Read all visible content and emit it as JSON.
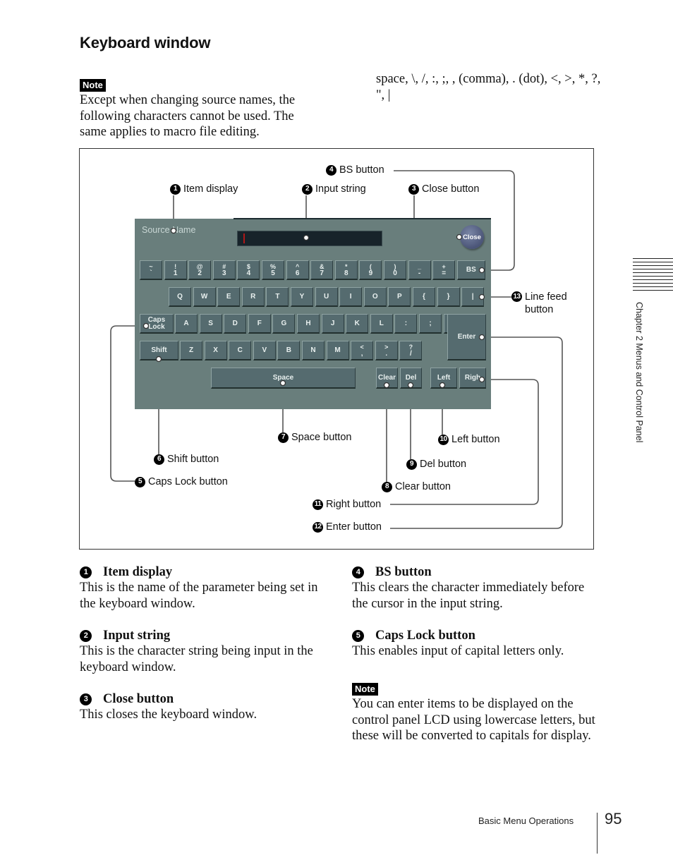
{
  "page": {
    "title": "Keyboard window",
    "note_label": "Note",
    "note_text": "Except when changing source names, the following characters cannot be used. The same applies to macro file editing.",
    "forbidden_chars": "space, \\, /, :, ;, , (comma), . (dot), <, >, *, ?, \", |"
  },
  "keyboard": {
    "item_display": "Source Name",
    "close_label": "Close",
    "row1": [
      {
        "top": "~",
        "bottom": "`"
      },
      {
        "top": "!",
        "bottom": "1"
      },
      {
        "top": "@",
        "bottom": "2"
      },
      {
        "top": "#",
        "bottom": "3"
      },
      {
        "top": "$",
        "bottom": "4"
      },
      {
        "top": "%",
        "bottom": "5"
      },
      {
        "top": "^",
        "bottom": "6"
      },
      {
        "top": "&",
        "bottom": "7"
      },
      {
        "top": "*",
        "bottom": "8"
      },
      {
        "top": "(",
        "bottom": "9"
      },
      {
        "top": ")",
        "bottom": "0"
      },
      {
        "top": "_",
        "bottom": "-"
      },
      {
        "top": "+",
        "bottom": "="
      }
    ],
    "bs_label": "BS",
    "row2": [
      "Q",
      "W",
      "E",
      "R",
      "T",
      "Y",
      "U",
      "I",
      "O",
      "P",
      "{",
      "}",
      "|"
    ],
    "caps_label": "Caps Lock",
    "row3": [
      "A",
      "S",
      "D",
      "F",
      "G",
      "H",
      "J",
      "K",
      "L",
      ":",
      ";",
      "\""
    ],
    "enter_label": "Enter",
    "shift_label": "Shift",
    "row4": [
      {
        "top": "",
        "bottom": "Z"
      },
      {
        "top": "",
        "bottom": "X"
      },
      {
        "top": "",
        "bottom": "C"
      },
      {
        "top": "",
        "bottom": "V"
      },
      {
        "top": "",
        "bottom": "B"
      },
      {
        "top": "",
        "bottom": "N"
      },
      {
        "top": "",
        "bottom": "M"
      },
      {
        "top": "<",
        "bottom": ","
      },
      {
        "top": ">",
        "bottom": "."
      },
      {
        "top": "?",
        "bottom": "/"
      }
    ],
    "space_label": "Space",
    "clear_label": "Clear",
    "del_label": "Del",
    "left_label": "Left",
    "right_label": "Righ"
  },
  "callouts": {
    "c1": {
      "num": "1",
      "label": "Item display"
    },
    "c2": {
      "num": "2",
      "label": "Input string"
    },
    "c3": {
      "num": "3",
      "label": "Close button"
    },
    "c4": {
      "num": "4",
      "label": "BS button"
    },
    "c5": {
      "num": "5",
      "label": "Caps Lock button"
    },
    "c6": {
      "num": "6",
      "label": "Shift button"
    },
    "c7": {
      "num": "7",
      "label": "Space button"
    },
    "c8": {
      "num": "8",
      "label": "Clear button"
    },
    "c9": {
      "num": "9",
      "label": "Del button"
    },
    "c10": {
      "num": "10",
      "label": "Left button"
    },
    "c11": {
      "num": "11",
      "label": "Right button"
    },
    "c12": {
      "num": "12",
      "label": "Enter button"
    },
    "c13": {
      "num": "13",
      "label_line1": "Line feed",
      "label_line2": "button"
    }
  },
  "descriptions": [
    {
      "num": "1",
      "title": "Item display",
      "text": "This is the name of the parameter being set in the keyboard window."
    },
    {
      "num": "2",
      "title": "Input string",
      "text": "This is the character string being input in the keyboard window."
    },
    {
      "num": "3",
      "title": "Close button",
      "text": "This closes the keyboard window."
    },
    {
      "num": "4",
      "title": "BS button",
      "text": "This clears the character immediately before the cursor in the input string."
    },
    {
      "num": "5",
      "title": "Caps Lock button",
      "text": "This enables input of capital letters only."
    }
  ],
  "note2": {
    "label": "Note",
    "text": "You can enter items to be displayed on the control panel LCD using lowercase letters, but these will be converted to capitals for display."
  },
  "sidebar": {
    "chapter_text": "Chapter 2  Menus and Control Panel"
  },
  "footer": {
    "section": "Basic Menu Operations",
    "page_number": "95"
  }
}
